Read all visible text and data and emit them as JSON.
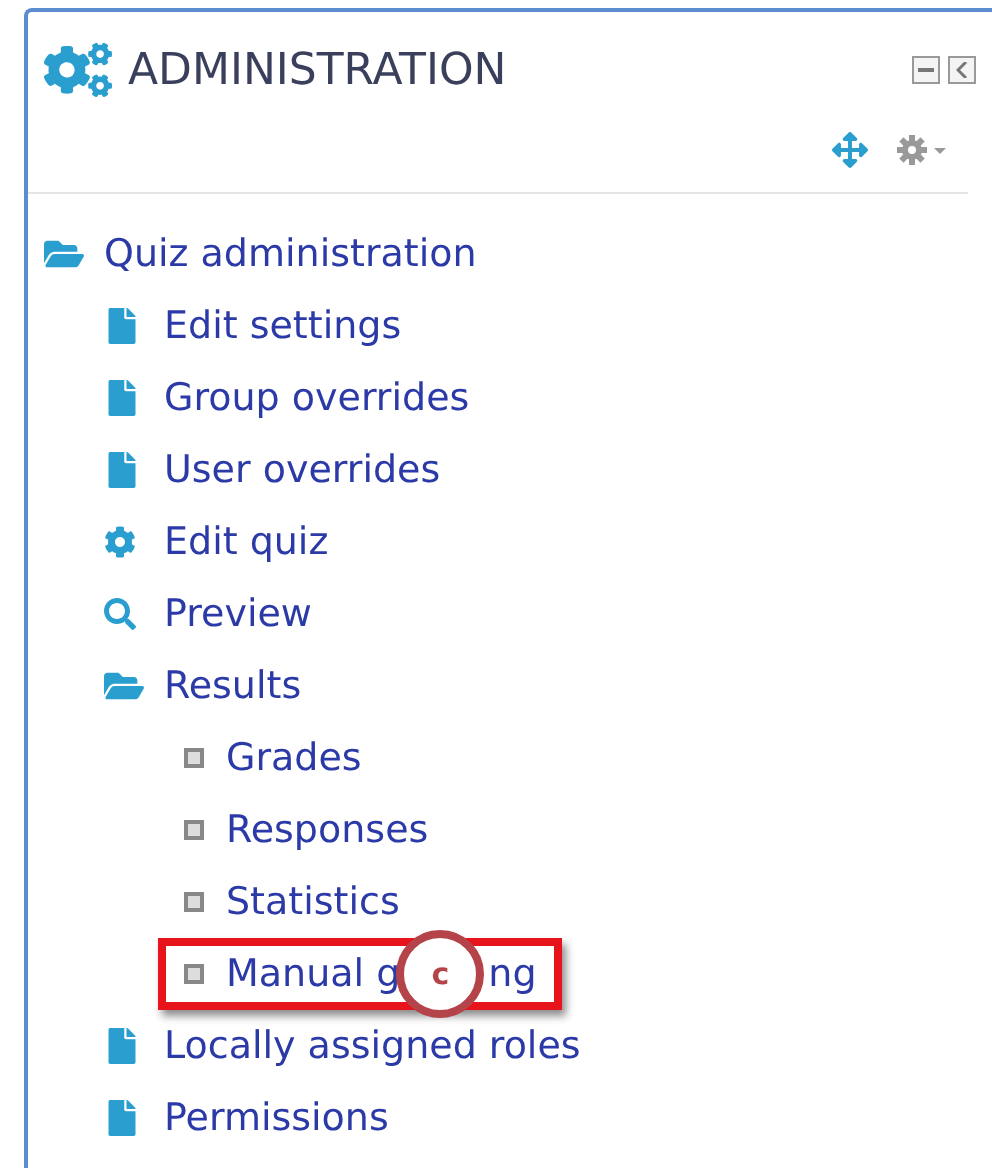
{
  "block": {
    "title": "ADMINISTRATION"
  },
  "tree": [
    {
      "kind": "folder",
      "label": "Quiz administration",
      "children": [
        {
          "kind": "file",
          "label": "Edit settings"
        },
        {
          "kind": "file",
          "label": "Group overrides"
        },
        {
          "kind": "file",
          "label": "User overrides"
        },
        {
          "kind": "gear",
          "label": "Edit quiz"
        },
        {
          "kind": "search",
          "label": "Preview"
        },
        {
          "kind": "folder",
          "label": "Results",
          "children": [
            {
              "kind": "bullet",
              "label": "Grades"
            },
            {
              "kind": "bullet",
              "label": "Responses"
            },
            {
              "kind": "bullet",
              "label": "Statistics"
            },
            {
              "kind": "bullet",
              "label": "Manual g",
              "label_tail": "ng",
              "highlighted": true,
              "callout": "c"
            }
          ]
        },
        {
          "kind": "file",
          "label": "Locally assigned roles"
        },
        {
          "kind": "file",
          "label": "Permissions"
        }
      ]
    }
  ]
}
